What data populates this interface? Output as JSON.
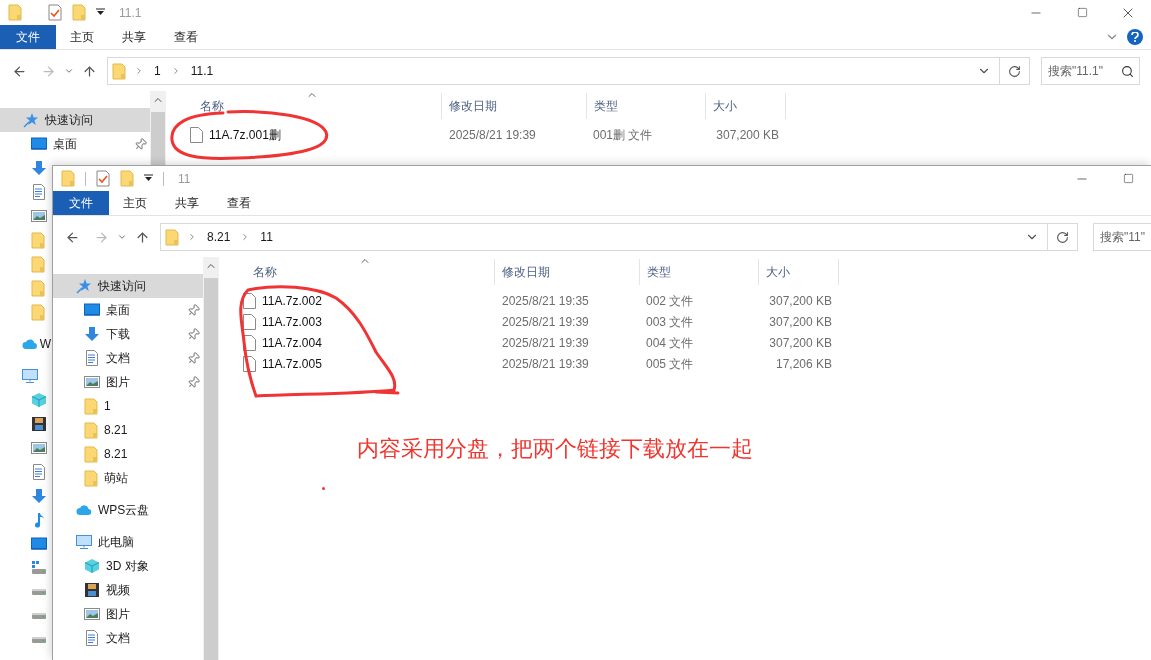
{
  "back_window": {
    "title": "11.1",
    "ribbon_tabs": [
      {
        "label": "文件",
        "selected": true
      },
      {
        "label": "主页",
        "selected": false
      },
      {
        "label": "共享",
        "selected": false
      },
      {
        "label": "查看",
        "selected": false
      }
    ],
    "breadcrumb": [
      "1",
      "11.1"
    ],
    "search": {
      "placeholder": "搜索\"11.1\""
    },
    "sidebar": [
      {
        "label": "快速访问",
        "kind": "star",
        "selected": true,
        "children": [
          {
            "label": "桌面",
            "kind": "desktop",
            "selected": false,
            "pinned": true
          },
          {
            "kind": "download",
            "selected": false
          },
          {
            "kind": "document",
            "selected": false
          },
          {
            "kind": "picture",
            "selected": false
          },
          {
            "kind": "folder",
            "selected": false
          },
          {
            "kind": "folder",
            "selected": false
          },
          {
            "kind": "folder",
            "selected": false
          },
          {
            "kind": "folder",
            "selected": false
          }
        ]
      },
      {
        "label": "W",
        "kind": "cloud",
        "selected": false
      },
      {
        "kind": "pc",
        "selected": false,
        "children": [
          {
            "kind": "cube",
            "selected": false
          },
          {
            "kind": "video",
            "selected": false
          },
          {
            "kind": "picture",
            "selected": false
          },
          {
            "kind": "document",
            "selected": false
          },
          {
            "kind": "download",
            "selected": false
          },
          {
            "kind": "music",
            "selected": false
          },
          {
            "kind": "desktop",
            "selected": false
          },
          {
            "kind": "netdrive",
            "selected": false
          },
          {
            "kind": "drive",
            "selected": false
          },
          {
            "kind": "drive",
            "selected": false
          },
          {
            "kind": "drive",
            "selected": false
          }
        ]
      }
    ],
    "columns": [
      "名称",
      "修改日期",
      "类型",
      "大小"
    ],
    "files": [
      {
        "name": "11A.7z.001删",
        "date": "2025/8/21 19:39",
        "type": "001删 文件",
        "size": "307,200 KB"
      }
    ]
  },
  "front_window": {
    "title": "11",
    "ribbon_tabs": [
      {
        "label": "文件",
        "selected": true
      },
      {
        "label": "主页",
        "selected": false
      },
      {
        "label": "共享",
        "selected": false
      },
      {
        "label": "查看",
        "selected": false
      }
    ],
    "breadcrumb": [
      "8.21",
      "11"
    ],
    "search": {
      "placeholder": "搜索\"11\""
    },
    "sidebar": [
      {
        "label": "快速访问",
        "kind": "star",
        "selected": true,
        "children": [
          {
            "label": "桌面",
            "kind": "desktop",
            "selected": false,
            "pinned": true
          },
          {
            "label": "下载",
            "kind": "download",
            "selected": false,
            "pinned": true
          },
          {
            "label": "文档",
            "kind": "document",
            "selected": false,
            "pinned": true
          },
          {
            "label": "图片",
            "kind": "picture",
            "selected": false,
            "pinned": true
          },
          {
            "label": "1",
            "kind": "folder",
            "selected": false,
            "pinned": false
          },
          {
            "label": "8.21",
            "kind": "folder",
            "selected": false,
            "pinned": false
          },
          {
            "label": "8.21",
            "kind": "folder",
            "selected": false,
            "pinned": false
          },
          {
            "label": "萌站",
            "kind": "folder",
            "selected": false,
            "pinned": false
          }
        ]
      },
      {
        "label": "WPS云盘",
        "kind": "cloud",
        "selected": false
      },
      {
        "label": "此电脑",
        "kind": "pc",
        "selected": false,
        "children": [
          {
            "label": "3D 对象",
            "kind": "cube",
            "selected": false
          },
          {
            "label": "视频",
            "kind": "video",
            "selected": false
          },
          {
            "label": "图片",
            "kind": "picture",
            "selected": false
          },
          {
            "label": "文档",
            "kind": "document",
            "selected": false
          }
        ]
      }
    ],
    "columns": [
      "名称",
      "修改日期",
      "类型",
      "大小"
    ],
    "files": [
      {
        "name": "11A.7z.002",
        "date": "2025/8/21 19:35",
        "type": "002 文件",
        "size": "307,200 KB"
      },
      {
        "name": "11A.7z.003",
        "date": "2025/8/21 19:39",
        "type": "003 文件",
        "size": "307,200 KB"
      },
      {
        "name": "11A.7z.004",
        "date": "2025/8/21 19:39",
        "type": "004 文件",
        "size": "307,200 KB"
      },
      {
        "name": "11A.7z.005",
        "date": "2025/8/21 19:39",
        "type": "005 文件",
        "size": "17,206 KB"
      }
    ]
  },
  "annotation": {
    "text": "内容采用分盘，把两个链接下载放在一起"
  }
}
